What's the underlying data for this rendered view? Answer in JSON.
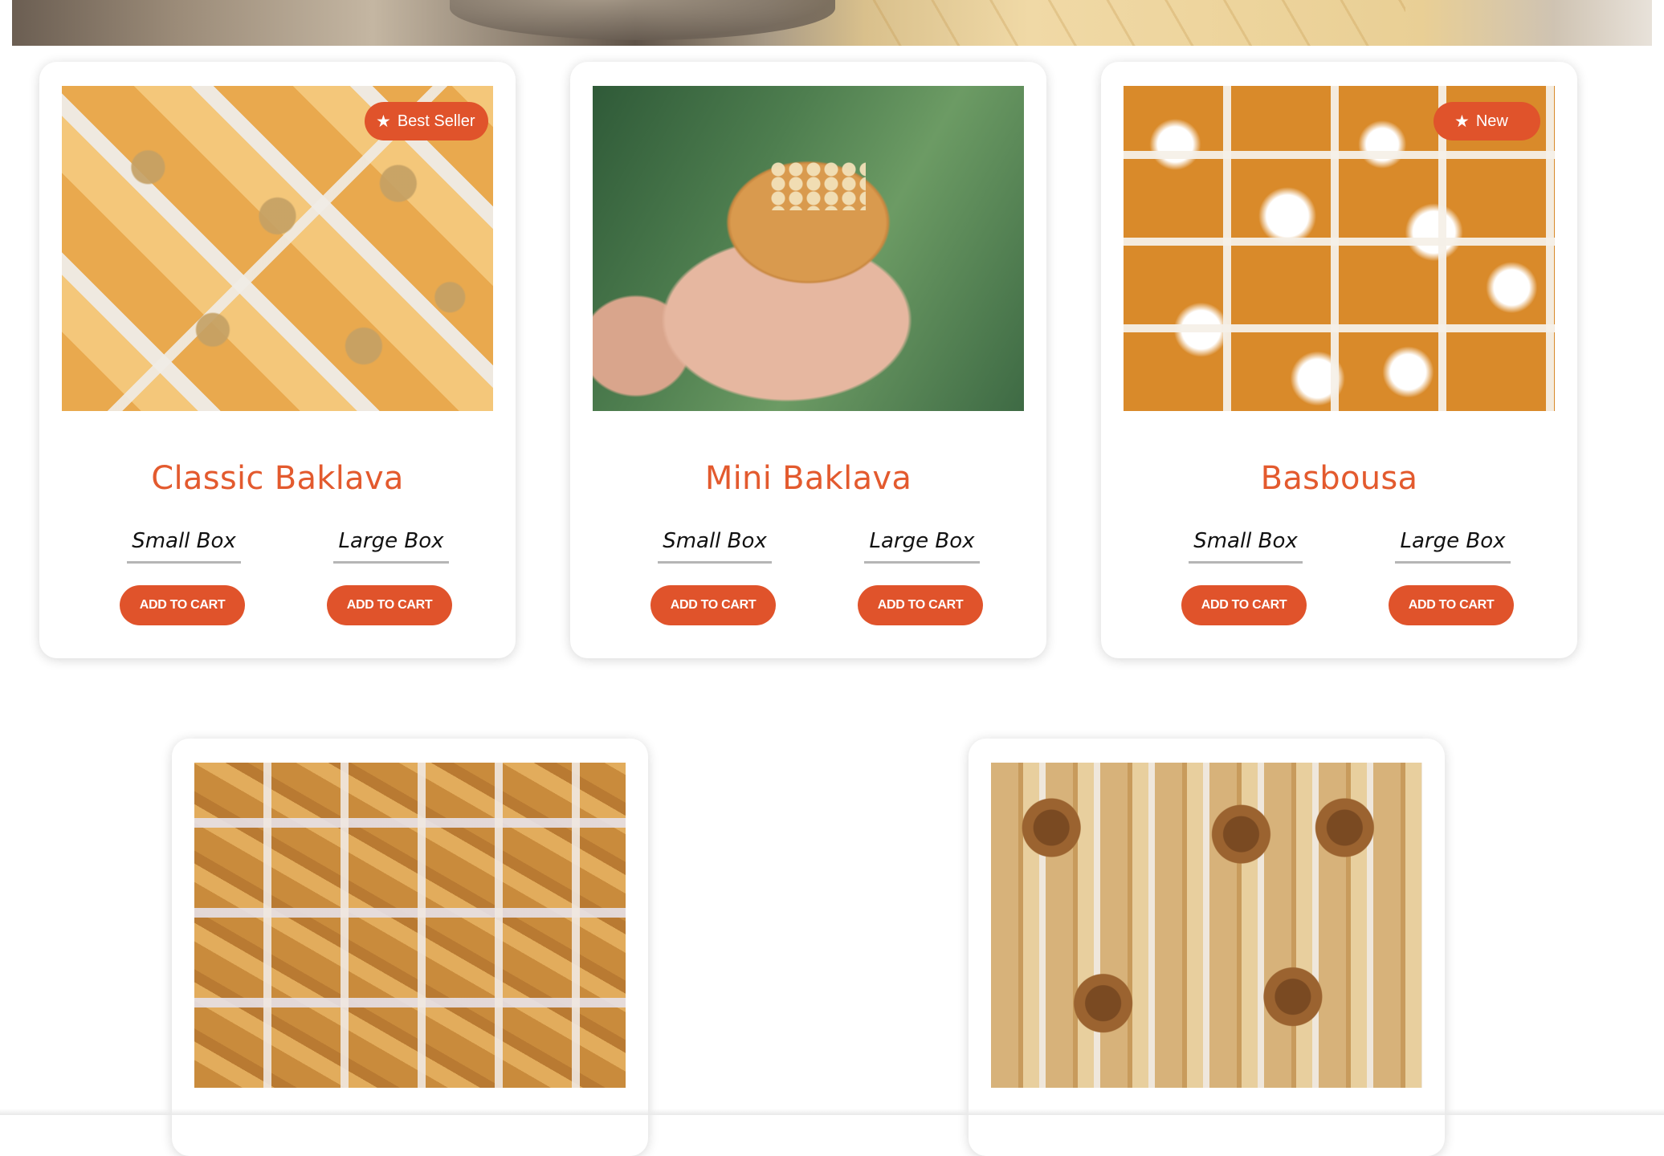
{
  "products": [
    {
      "name": "Classic Baklava",
      "badge": "Best Seller",
      "options": [
        {
          "label": "Small Box",
          "button": "ADD TO CART"
        },
        {
          "label": "Large Box",
          "button": "ADD TO CART"
        }
      ]
    },
    {
      "name": "Mini Baklava",
      "options": [
        {
          "label": "Small Box",
          "button": "ADD TO CART"
        },
        {
          "label": "Large Box",
          "button": "ADD TO CART"
        }
      ]
    },
    {
      "name": "Basbousa",
      "badge": "New",
      "options": [
        {
          "label": "Small Box",
          "button": "ADD TO CART"
        },
        {
          "label": "Large Box",
          "button": "ADD TO CART"
        }
      ]
    }
  ],
  "icons": {
    "badge_icon": "star-icon"
  },
  "colors": {
    "accent": "#e0532b",
    "title": "#e35a2e",
    "card_bg": "#ffffff"
  }
}
